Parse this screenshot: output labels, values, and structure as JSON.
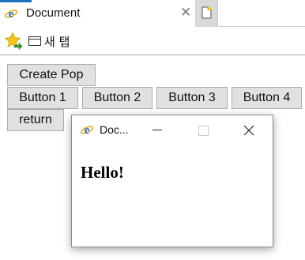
{
  "tab": {
    "title": "Document",
    "close_glyph": "✕",
    "icon": "ie-icon"
  },
  "new_tab": {
    "icon": "new-tab-icon"
  },
  "favorites_bar": {
    "favorites_icon": "star-add-icon",
    "item_label": "새 탭",
    "item_icon": "page-icon"
  },
  "buttons": {
    "create_pop": "Create Pop",
    "button1": "Button 1",
    "button2": "Button 2",
    "button3": "Button 3",
    "button4": "Button 4",
    "return": "return"
  },
  "popup": {
    "title": "Doc...",
    "icon": "ie-icon",
    "heading": "Hello!"
  },
  "colors": {
    "ie_blue": "#1d6fc4",
    "button_face": "#e1e1e1",
    "button_border": "#adadad",
    "star_gold": "#f5c518",
    "arrow_green": "#3a9a2a"
  }
}
